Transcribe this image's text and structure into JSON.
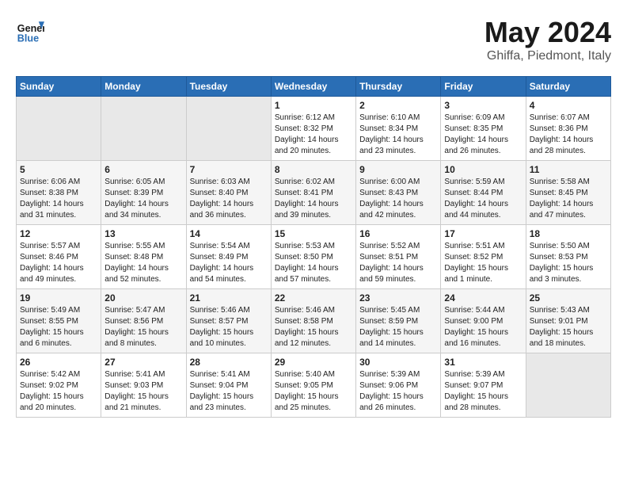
{
  "header": {
    "logo_line1": "General",
    "logo_line2": "Blue",
    "title": "May 2024",
    "subtitle": "Ghiffa, Piedmont, Italy"
  },
  "days_of_week": [
    "Sunday",
    "Monday",
    "Tuesday",
    "Wednesday",
    "Thursday",
    "Friday",
    "Saturday"
  ],
  "weeks": [
    [
      {
        "day": "",
        "empty": true
      },
      {
        "day": "",
        "empty": true
      },
      {
        "day": "",
        "empty": true
      },
      {
        "day": "1",
        "sunrise": "6:12 AM",
        "sunset": "8:32 PM",
        "daylight": "14 hours and 20 minutes."
      },
      {
        "day": "2",
        "sunrise": "6:10 AM",
        "sunset": "8:34 PM",
        "daylight": "14 hours and 23 minutes."
      },
      {
        "day": "3",
        "sunrise": "6:09 AM",
        "sunset": "8:35 PM",
        "daylight": "14 hours and 26 minutes."
      },
      {
        "day": "4",
        "sunrise": "6:07 AM",
        "sunset": "8:36 PM",
        "daylight": "14 hours and 28 minutes."
      }
    ],
    [
      {
        "day": "5",
        "sunrise": "6:06 AM",
        "sunset": "8:38 PM",
        "daylight": "14 hours and 31 minutes."
      },
      {
        "day": "6",
        "sunrise": "6:05 AM",
        "sunset": "8:39 PM",
        "daylight": "14 hours and 34 minutes."
      },
      {
        "day": "7",
        "sunrise": "6:03 AM",
        "sunset": "8:40 PM",
        "daylight": "14 hours and 36 minutes."
      },
      {
        "day": "8",
        "sunrise": "6:02 AM",
        "sunset": "8:41 PM",
        "daylight": "14 hours and 39 minutes."
      },
      {
        "day": "9",
        "sunrise": "6:00 AM",
        "sunset": "8:43 PM",
        "daylight": "14 hours and 42 minutes."
      },
      {
        "day": "10",
        "sunrise": "5:59 AM",
        "sunset": "8:44 PM",
        "daylight": "14 hours and 44 minutes."
      },
      {
        "day": "11",
        "sunrise": "5:58 AM",
        "sunset": "8:45 PM",
        "daylight": "14 hours and 47 minutes."
      }
    ],
    [
      {
        "day": "12",
        "sunrise": "5:57 AM",
        "sunset": "8:46 PM",
        "daylight": "14 hours and 49 minutes."
      },
      {
        "day": "13",
        "sunrise": "5:55 AM",
        "sunset": "8:48 PM",
        "daylight": "14 hours and 52 minutes."
      },
      {
        "day": "14",
        "sunrise": "5:54 AM",
        "sunset": "8:49 PM",
        "daylight": "14 hours and 54 minutes."
      },
      {
        "day": "15",
        "sunrise": "5:53 AM",
        "sunset": "8:50 PM",
        "daylight": "14 hours and 57 minutes."
      },
      {
        "day": "16",
        "sunrise": "5:52 AM",
        "sunset": "8:51 PM",
        "daylight": "14 hours and 59 minutes."
      },
      {
        "day": "17",
        "sunrise": "5:51 AM",
        "sunset": "8:52 PM",
        "daylight": "15 hours and 1 minute."
      },
      {
        "day": "18",
        "sunrise": "5:50 AM",
        "sunset": "8:53 PM",
        "daylight": "15 hours and 3 minutes."
      }
    ],
    [
      {
        "day": "19",
        "sunrise": "5:49 AM",
        "sunset": "8:55 PM",
        "daylight": "15 hours and 6 minutes."
      },
      {
        "day": "20",
        "sunrise": "5:47 AM",
        "sunset": "8:56 PM",
        "daylight": "15 hours and 8 minutes."
      },
      {
        "day": "21",
        "sunrise": "5:46 AM",
        "sunset": "8:57 PM",
        "daylight": "15 hours and 10 minutes."
      },
      {
        "day": "22",
        "sunrise": "5:46 AM",
        "sunset": "8:58 PM",
        "daylight": "15 hours and 12 minutes."
      },
      {
        "day": "23",
        "sunrise": "5:45 AM",
        "sunset": "8:59 PM",
        "daylight": "15 hours and 14 minutes."
      },
      {
        "day": "24",
        "sunrise": "5:44 AM",
        "sunset": "9:00 PM",
        "daylight": "15 hours and 16 minutes."
      },
      {
        "day": "25",
        "sunrise": "5:43 AM",
        "sunset": "9:01 PM",
        "daylight": "15 hours and 18 minutes."
      }
    ],
    [
      {
        "day": "26",
        "sunrise": "5:42 AM",
        "sunset": "9:02 PM",
        "daylight": "15 hours and 20 minutes."
      },
      {
        "day": "27",
        "sunrise": "5:41 AM",
        "sunset": "9:03 PM",
        "daylight": "15 hours and 21 minutes."
      },
      {
        "day": "28",
        "sunrise": "5:41 AM",
        "sunset": "9:04 PM",
        "daylight": "15 hours and 23 minutes."
      },
      {
        "day": "29",
        "sunrise": "5:40 AM",
        "sunset": "9:05 PM",
        "daylight": "15 hours and 25 minutes."
      },
      {
        "day": "30",
        "sunrise": "5:39 AM",
        "sunset": "9:06 PM",
        "daylight": "15 hours and 26 minutes."
      },
      {
        "day": "31",
        "sunrise": "5:39 AM",
        "sunset": "9:07 PM",
        "daylight": "15 hours and 28 minutes."
      },
      {
        "day": "",
        "empty": true
      }
    ]
  ]
}
